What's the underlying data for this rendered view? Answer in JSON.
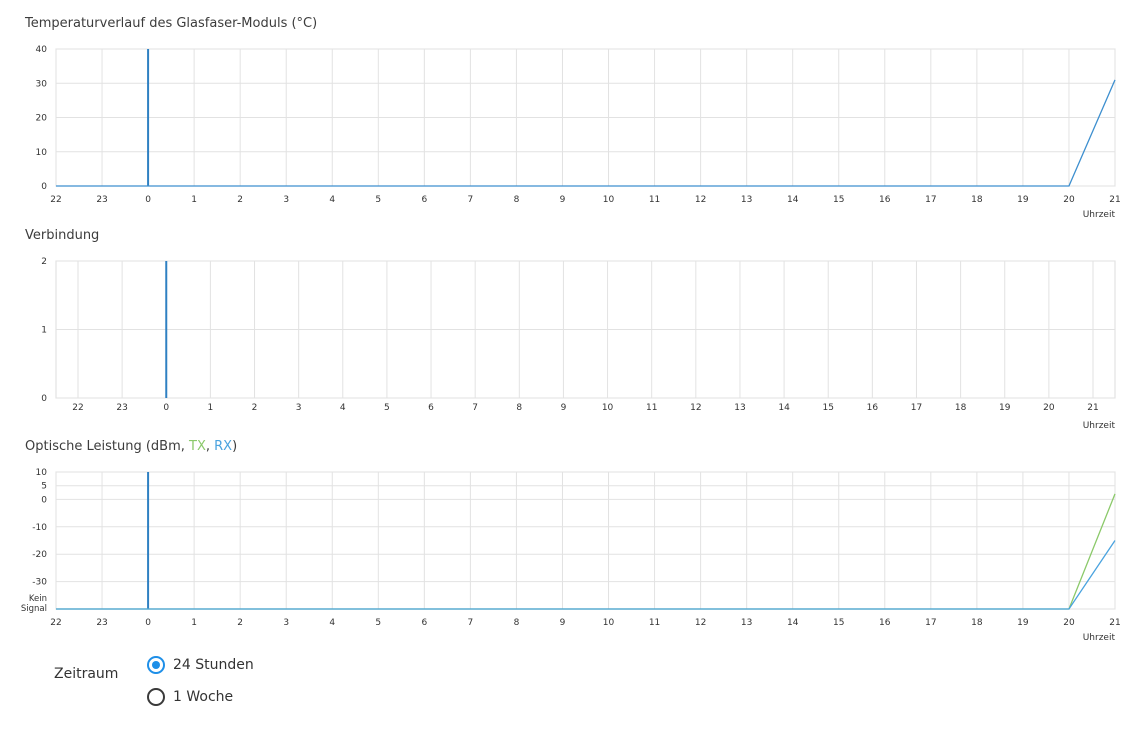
{
  "chart_data": [
    {
      "type": "line",
      "title": "Temperaturverlauf des Glasfaser-Moduls (°C)",
      "xlabel": "Uhrzeit",
      "ylabel": "",
      "x_ticks": [
        "22",
        "23",
        "0",
        "1",
        "2",
        "3",
        "4",
        "5",
        "6",
        "7",
        "8",
        "9",
        "10",
        "11",
        "12",
        "13",
        "14",
        "15",
        "16",
        "17",
        "18",
        "19",
        "20",
        "21"
      ],
      "y_ticks": [
        "0",
        "10",
        "20",
        "30",
        "40"
      ],
      "y_tick_values": [
        0,
        10,
        20,
        30,
        40
      ],
      "ylim": [
        0,
        40
      ],
      "grid": true,
      "day_marker_x": "0",
      "series": [
        {
          "color": "#3d8fcf",
          "points": [
            [
              "22",
              0
            ],
            [
              "20",
              0
            ],
            [
              "21",
              31
            ]
          ]
        }
      ]
    },
    {
      "type": "line",
      "title": "Verbindung",
      "xlabel": "Uhrzeit",
      "ylabel": "",
      "x_ticks": [
        "22",
        "23",
        "0",
        "1",
        "2",
        "3",
        "4",
        "5",
        "6",
        "7",
        "8",
        "9",
        "10",
        "11",
        "12",
        "13",
        "14",
        "15",
        "16",
        "17",
        "18",
        "19",
        "20",
        "21"
      ],
      "y_ticks": [
        "0",
        "1",
        "2"
      ],
      "y_tick_values": [
        0,
        1,
        2
      ],
      "ylim": [
        0,
        2
      ],
      "grid": true,
      "day_marker_x": "0",
      "series": []
    },
    {
      "type": "line",
      "title": "Optische Leistung (dBm, TX, RX)",
      "title_parts": {
        "prefix": "Optische Leistung (dBm, ",
        "tx": "TX",
        "sep": ", ",
        "rx": "RX",
        "suffix": ")"
      },
      "xlabel": "Uhrzeit",
      "ylabel": "",
      "x_ticks": [
        "22",
        "23",
        "0",
        "1",
        "2",
        "3",
        "4",
        "5",
        "6",
        "7",
        "8",
        "9",
        "10",
        "11",
        "12",
        "13",
        "14",
        "15",
        "16",
        "17",
        "18",
        "19",
        "20",
        "21"
      ],
      "y_ticks": [
        "Kein Signal",
        "-30",
        "-20",
        "-10",
        "0",
        "5",
        "10"
      ],
      "y_tick_values": [
        -40,
        -30,
        -20,
        -10,
        0,
        5,
        10
      ],
      "ylim": [
        -40,
        10
      ],
      "grid": true,
      "day_marker_x": "0",
      "series": [
        {
          "name": "TX",
          "color": "#8bc96a",
          "points": [
            [
              "22",
              -40
            ],
            [
              "20",
              -40
            ],
            [
              "21",
              2
            ]
          ]
        },
        {
          "name": "RX",
          "color": "#4aa3df",
          "points": [
            [
              "22",
              -40
            ],
            [
              "20",
              -40
            ],
            [
              "21",
              -15
            ]
          ]
        }
      ]
    }
  ],
  "controls": {
    "label": "Zeitraum",
    "options": [
      {
        "label": "24 Stunden",
        "checked": true
      },
      {
        "label": "1 Woche",
        "checked": false
      }
    ]
  }
}
